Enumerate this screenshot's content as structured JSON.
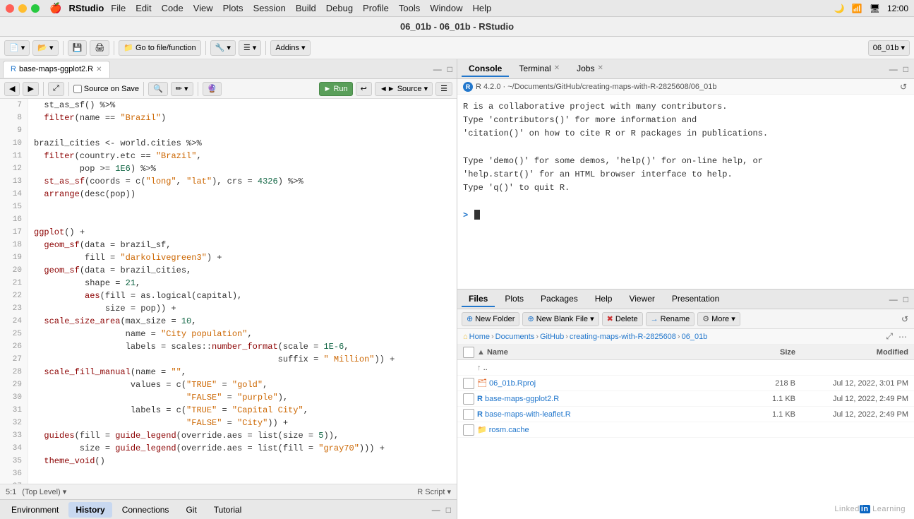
{
  "menubar": {
    "app": "RStudio",
    "menus": [
      "File",
      "Edit",
      "Code",
      "View",
      "Plots",
      "Session",
      "Build",
      "Debug",
      "Profile",
      "Tools",
      "Window",
      "Help"
    ]
  },
  "titlebar": {
    "title": "06_01b - 06_01b - RStudio"
  },
  "toolbar": {
    "goto_placeholder": "Go to file/function",
    "addins_label": "Addins ▾",
    "project": "06_01b ▾"
  },
  "editor": {
    "tab_label": "base-maps-ggplot2.R",
    "source_on_save": "Source on Save",
    "run_label": "► Run",
    "source_label": "◄► Source ▾",
    "lines": [
      {
        "num": 7,
        "code": "  st_as_sf() %>%"
      },
      {
        "num": 8,
        "code": "  filter(name == \"Brazil\")"
      },
      {
        "num": 9,
        "code": ""
      },
      {
        "num": 10,
        "code": "brazil_cities <- world.cities %>%"
      },
      {
        "num": 11,
        "code": "  filter(country.etc == \"Brazil\","
      },
      {
        "num": 12,
        "code": "         pop >= 1E6) %>%"
      },
      {
        "num": 13,
        "code": "  st_as_sf(coords = c(\"long\", \"lat\"), crs = 4326) %>%"
      },
      {
        "num": 14,
        "code": "  arrange(desc(pop))"
      },
      {
        "num": 15,
        "code": ""
      },
      {
        "num": 16,
        "code": ""
      },
      {
        "num": 17,
        "code": "ggplot() +"
      },
      {
        "num": 18,
        "code": "  geom_sf(data = brazil_sf,"
      },
      {
        "num": 19,
        "code": "          fill = \"darkolivegreen3\") +"
      },
      {
        "num": 20,
        "code": "  geom_sf(data = brazil_cities,"
      },
      {
        "num": 21,
        "code": "          shape = 21,"
      },
      {
        "num": 22,
        "code": "          aes(fill = as.logical(capital),"
      },
      {
        "num": 23,
        "code": "              size = pop)) +"
      },
      {
        "num": 24,
        "code": "  scale_size_area(max_size = 10,"
      },
      {
        "num": 25,
        "code": "                  name = \"City population\","
      },
      {
        "num": 26,
        "code": "                  labels = scales::number_format(scale = 1E-6,"
      },
      {
        "num": 27,
        "code": "                                                suffix = \" Million\")) +"
      },
      {
        "num": 28,
        "code": "  scale_fill_manual(name = \"\","
      },
      {
        "num": 29,
        "code": "                   values = c(\"TRUE\" = \"gold\","
      },
      {
        "num": 30,
        "code": "                              \"FALSE\" = \"purple\"),"
      },
      {
        "num": 31,
        "code": "                   labels = c(\"TRUE\" = \"Capital City\","
      },
      {
        "num": 32,
        "code": "                              \"FALSE\" = \"City\")) +"
      },
      {
        "num": 33,
        "code": "  guides(fill = guide_legend(override.aes = list(size = 5)),"
      },
      {
        "num": 34,
        "code": "         size = guide_legend(override.aes = list(fill = \"gray70\"))) +"
      },
      {
        "num": 35,
        "code": "  theme_void()"
      },
      {
        "num": 36,
        "code": ""
      },
      {
        "num": 37,
        "code": ""
      }
    ],
    "status_left": "5:1",
    "status_level": "(Top Level) ▾",
    "status_right": "R Script ▾"
  },
  "console": {
    "tabs": [
      {
        "label": "Console",
        "active": true
      },
      {
        "label": "Terminal",
        "closable": true
      },
      {
        "label": "Jobs",
        "closable": true
      }
    ],
    "path": "R 4.2.0 · ~/Documents/GitHub/creating-maps-with-R-2825608/06_01b",
    "content": "R is a collaborative project with many contributors.\nType 'contributors()' for more information and\n'citation()' on how to cite R or R packages in publications.\n\nType 'demo()' for some demos, 'help()' for on-line help, or\n'help.start()' for an HTML browser interface to help.\nType 'q()' to quit R.",
    "prompt": ">"
  },
  "files": {
    "tabs": [
      "Files",
      "Plots",
      "Packages",
      "Help",
      "Viewer",
      "Presentation"
    ],
    "active_tab": "Files",
    "toolbar": {
      "new_folder": "⊕ New Folder",
      "new_blank": "⊕ New Blank File ▾",
      "delete": "✖ Delete",
      "rename": "→ Rename",
      "more": "⚙ More ▾"
    },
    "breadcrumbs": [
      "Home",
      "Documents",
      "GitHub",
      "creating-maps-with-R-2825608",
      "06_01b"
    ],
    "columns": [
      "Name",
      "Size",
      "Modified"
    ],
    "rows": [
      {
        "name": "..",
        "type": "up",
        "size": "",
        "modified": ""
      },
      {
        "name": "06_01b.Rproj",
        "type": "rproj",
        "size": "218 B",
        "modified": "Jul 12, 2022, 3:01 PM"
      },
      {
        "name": "base-maps-ggplot2.R",
        "type": "r",
        "size": "1.1 KB",
        "modified": "Jul 12, 2022, 2:49 PM"
      },
      {
        "name": "base-maps-with-leaflet.R",
        "type": "r",
        "size": "1.1 KB",
        "modified": "Jul 12, 2022, 2:49 PM"
      },
      {
        "name": "rosm.cache",
        "type": "folder",
        "size": "",
        "modified": ""
      }
    ]
  },
  "bottom_tabs": {
    "items": [
      "Environment",
      "History",
      "Connections",
      "Git",
      "Tutorial"
    ],
    "active": "History"
  }
}
